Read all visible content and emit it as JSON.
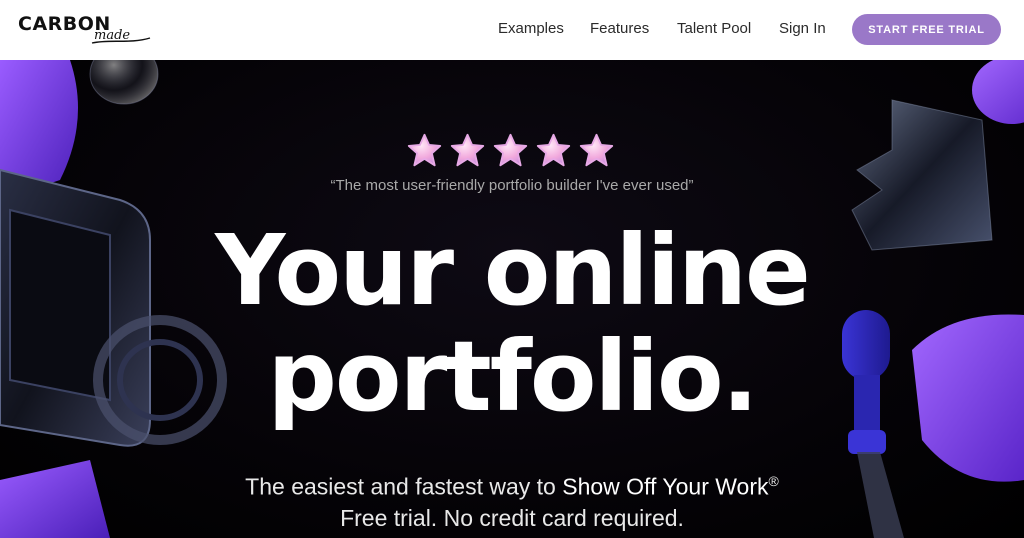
{
  "brand": {
    "name": "CARBON",
    "tagline": "made"
  },
  "nav": {
    "links": [
      "Examples",
      "Features",
      "Talent Pool",
      "Sign In"
    ],
    "cta": "START FREE TRIAL"
  },
  "hero": {
    "rating_stars": 5,
    "quote": "“The most user-friendly portfolio builder I've ever used”",
    "headline_line1": "Your online",
    "headline_line2": "portfolio.",
    "sub_prefix": "The easiest and fastest way to ",
    "sub_emphasis": "Show Off Your Work",
    "sub_mark": "®",
    "sub_line2": "Free trial. No credit card required."
  },
  "colors": {
    "cta": "#9a78c8",
    "accent_purple": "#7b3ff0",
    "background": "#000000"
  }
}
